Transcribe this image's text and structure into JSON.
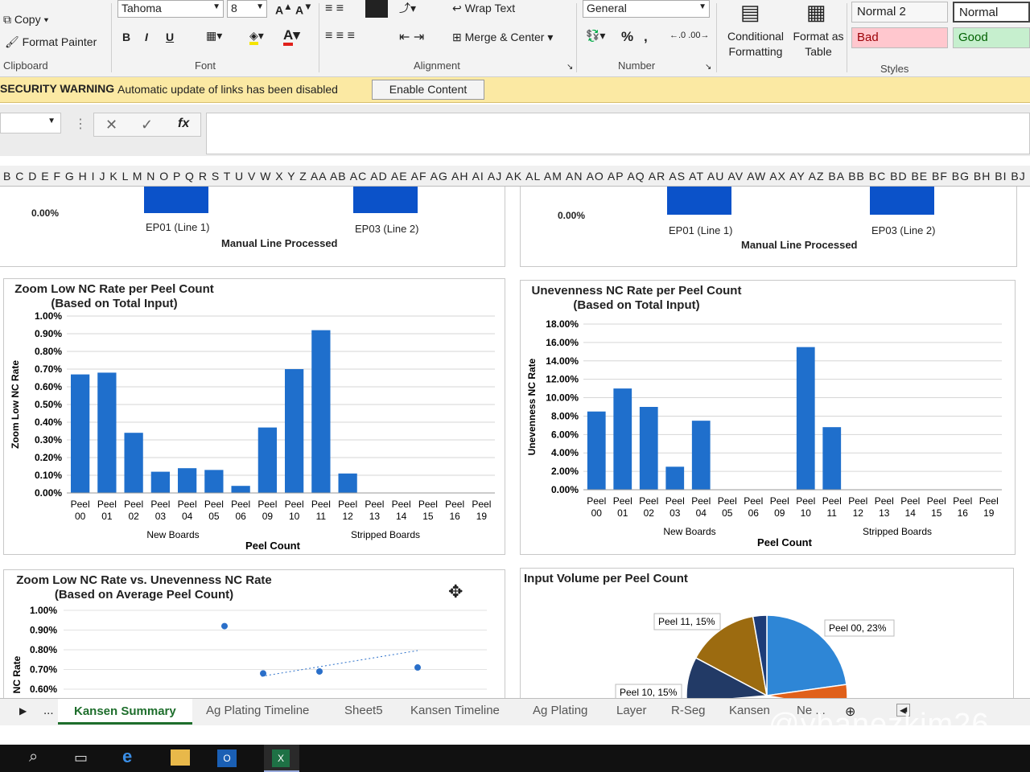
{
  "ribbon": {
    "copy_label": "Copy",
    "format_painter_label": "Format Painter",
    "clipboard_group": "Clipboard",
    "font_name": "Tahoma",
    "font_size": "8",
    "bold_label": "B",
    "italic_label": "I",
    "underline_label": "U",
    "font_group": "Font",
    "wrap_text_label": "Wrap Text",
    "merge_center_label": "Merge & Center",
    "alignment_group": "Alignment",
    "number_format": "General",
    "percent_label": "%",
    "comma_label": ",",
    "number_group": "Number",
    "conditional_formatting_label": "Conditional Formatting",
    "format_as_table_label": "Format as Table",
    "styles_group": "Styles",
    "style_normal2": "Normal 2",
    "style_normal": "Normal",
    "style_bad": "Bad",
    "style_good": "Good"
  },
  "security_bar": {
    "title": "SECURITY WARNING",
    "message": "Automatic update of links has been disabled",
    "button_label": "Enable Content"
  },
  "formula_bar": {
    "name_box": "",
    "fx_label": "fx",
    "formula": ""
  },
  "column_headers": "B C D E F G H I J K L M N O P Q R S T U V W X Y Z AA AB AC AD AE AF AG AH AI AJ AK AL AM AN AO AP AQ AR AS AT AU AV AW AX AY AZ BA BB BC BD BE BF BG BH BI BJ BK BL BM BN BO",
  "top_charts": {
    "left_zero": "0.00%",
    "right_zero": "0.00%",
    "left_cat1": "EP01 (Line 1)",
    "left_cat2": "EP03 (Line 2)",
    "right_cat1": "EP01 (Line 1)",
    "right_cat2": "EP03 (Line 2)",
    "left_xlabel": "Manual Line Processed",
    "right_xlabel": "Manual Line Processed"
  },
  "chart_data": [
    {
      "type": "bar",
      "title": "Zoom Low NC Rate per Peel Count",
      "subtitle": "(Based on Total Input)",
      "ylabel": "Zoom Low NC Rate",
      "xlabel": "Peel Count",
      "group_labels": [
        "New Boards",
        "Stripped Boards"
      ],
      "categories": [
        "Peel 00",
        "Peel 01",
        "Peel 02",
        "Peel 03",
        "Peel 04",
        "Peel 05",
        "Peel 06",
        "Peel 09",
        "Peel 10",
        "Peel 11",
        "Peel 12",
        "Peel 13",
        "Peel 14",
        "Peel 15",
        "Peel 16",
        "Peel 19"
      ],
      "values": [
        0.67,
        0.68,
        0.34,
        0.12,
        0.14,
        0.13,
        0.04,
        0.37,
        0.7,
        0.92,
        0.11,
        0,
        0,
        0,
        0,
        0
      ],
      "yticks": [
        "0.00%",
        "0.10%",
        "0.20%",
        "0.30%",
        "0.40%",
        "0.50%",
        "0.60%",
        "0.70%",
        "0.80%",
        "0.90%",
        "1.00%"
      ],
      "ylim": [
        0,
        1.0
      ],
      "color": "#1f6fcc"
    },
    {
      "type": "bar",
      "title": "Unevenness NC Rate per Peel Count",
      "subtitle": "(Based on Total Input)",
      "ylabel": "Unevenness NC Rate",
      "xlabel": "Peel Count",
      "group_labels": [
        "New Boards",
        "Stripped Boards"
      ],
      "categories": [
        "Peel 00",
        "Peel 01",
        "Peel 02",
        "Peel 03",
        "Peel 04",
        "Peel 05",
        "Peel 06",
        "Peel 09",
        "Peel 10",
        "Peel 11",
        "Peel 12",
        "Peel 13",
        "Peel 14",
        "Peel 15",
        "Peel 16",
        "Peel 19"
      ],
      "values": [
        8.5,
        11.0,
        9.0,
        2.5,
        7.5,
        0,
        0,
        0,
        15.5,
        6.8,
        0,
        0,
        0,
        0,
        0,
        0
      ],
      "yticks": [
        "0.00%",
        "2.00%",
        "4.00%",
        "6.00%",
        "8.00%",
        "10.00%",
        "12.00%",
        "14.00%",
        "16.00%",
        "18.00%"
      ],
      "ylim": [
        0,
        18
      ],
      "color": "#1f6fcc"
    },
    {
      "type": "scatter",
      "title": "Zoom Low NC Rate vs. Unevenness NC Rate",
      "subtitle": "(Based on Average Peel Count)",
      "ylabel": "NC Rate",
      "yticks": [
        "0.60%",
        "0.70%",
        "0.80%",
        "0.90%",
        "1.00%"
      ],
      "points": [
        {
          "x": 1,
          "y": 0.92
        },
        {
          "x": 2,
          "y": 0.68
        },
        {
          "x": 3,
          "y": 0.69
        },
        {
          "x": 4,
          "y": 0.71
        }
      ]
    },
    {
      "type": "pie",
      "title": "Input Volume per Peel Count",
      "slices": [
        {
          "label": "Peel 00, 23%",
          "value": 23,
          "color": "#2e86d6"
        },
        {
          "label": "Peel 11, 15%",
          "value": 15,
          "color": "#9c6b10"
        },
        {
          "label": "Peel 10, 15%",
          "value": 15,
          "color": "#223a66"
        }
      ]
    }
  ],
  "sheet_tabs": [
    {
      "label": "Kansen Summary",
      "active": true
    },
    {
      "label": "Ag Plating Timeline",
      "active": false
    },
    {
      "label": "Sheet5",
      "active": false
    },
    {
      "label": "Kansen Timeline",
      "active": false
    },
    {
      "label": "Ag Plating",
      "active": false
    },
    {
      "label": "Layer",
      "active": false
    },
    {
      "label": "R-Seg",
      "active": false
    },
    {
      "label": "Kansen",
      "active": false
    },
    {
      "label": "Ne ...",
      "active": false
    }
  ],
  "watermark": "@ybanezkim26"
}
